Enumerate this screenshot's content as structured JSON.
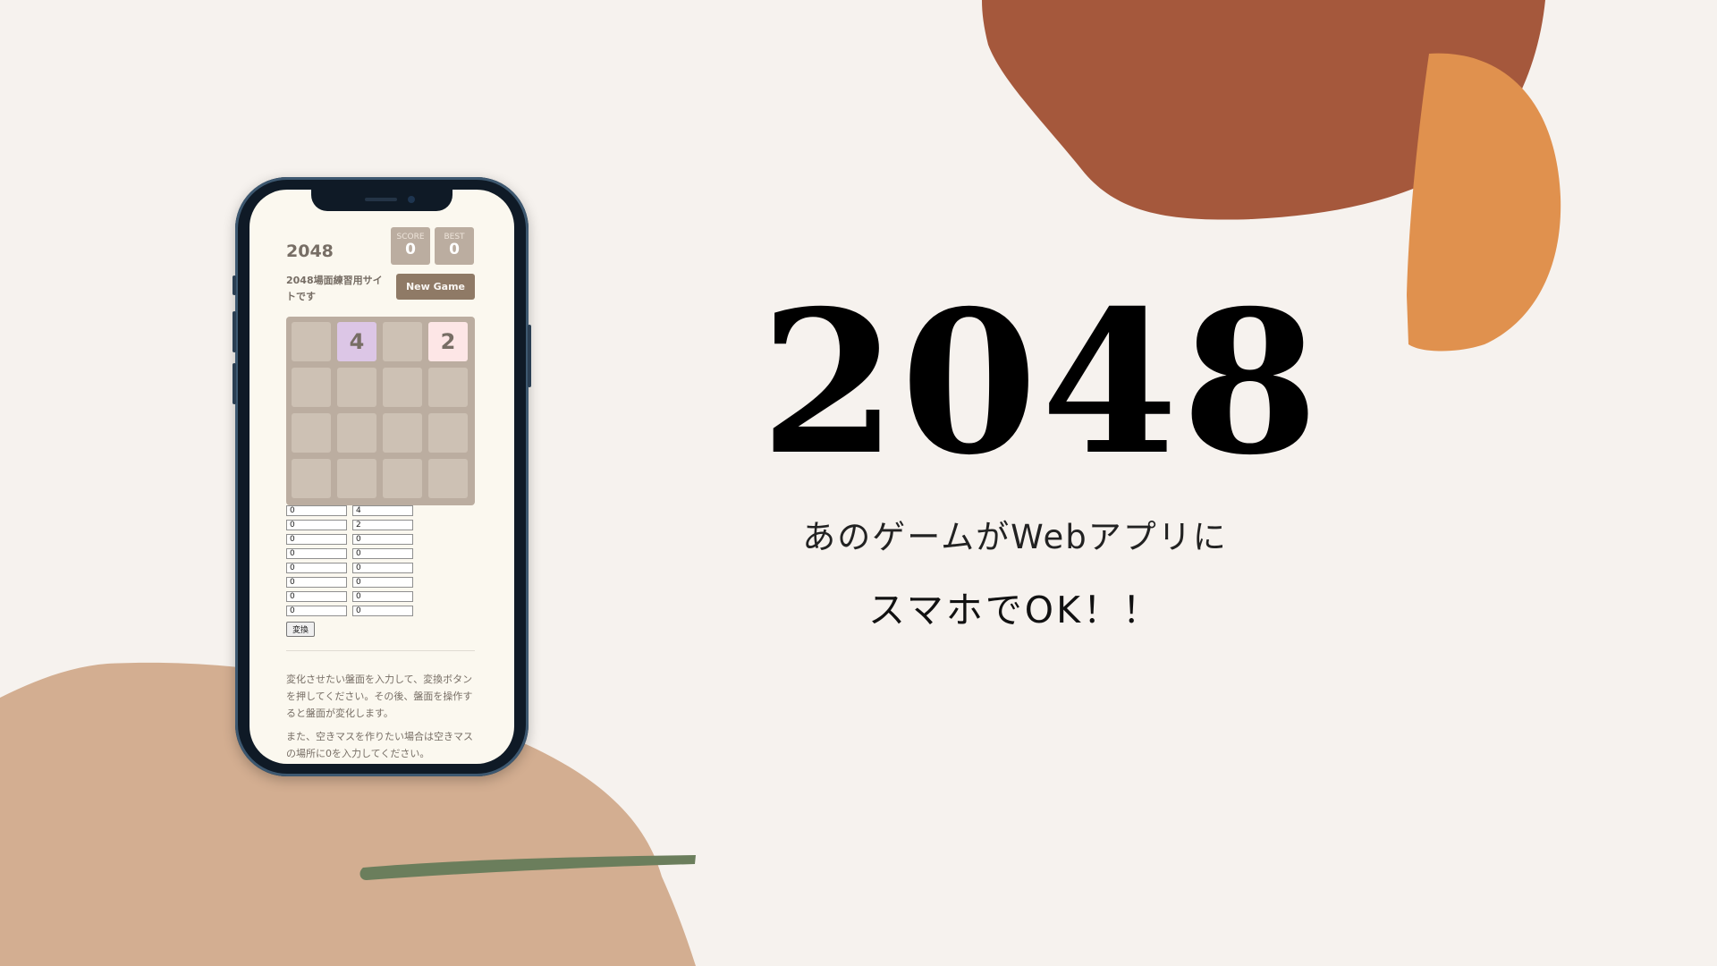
{
  "phone_app": {
    "title": "2048",
    "score": {
      "label": "SCORE",
      "value": "0"
    },
    "best": {
      "label": "BEST",
      "value": "0"
    },
    "subtitle": "2048場面練習用サイトです",
    "new_game_label": "New Game",
    "board_tiles": [
      "",
      "4",
      "",
      "2",
      "",
      "",
      "",
      "",
      "",
      "",
      "",
      "",
      "",
      "",
      "",
      ""
    ],
    "inputs_left": [
      "0",
      "0",
      "0",
      "0",
      "0",
      "0",
      "0",
      "0"
    ],
    "inputs_right": [
      "4",
      "2",
      "0",
      "0",
      "0",
      "0",
      "0",
      "0"
    ],
    "convert_label": "変換",
    "description_1": "変化させたい盤面を入力して、変換ボタンを押してください。その後、盤面を操作すると盤面が変化します。",
    "description_2": "また、空きマスを作りたい場合は空きマスの場所に0を入力してください。"
  },
  "hero": {
    "title": "2048",
    "tagline_1": "あのゲームがWebアプリに",
    "tagline_2": "スマホでOK！！"
  },
  "colors": {
    "background": "#f6f2ee",
    "blob_rust": "#a5583c",
    "blob_orange": "#e0914e",
    "blob_tan": "#d3ae91",
    "stroke_green": "#6b7e5c",
    "tile_4": "#dcc6e6",
    "tile_2": "#fde6e6"
  }
}
